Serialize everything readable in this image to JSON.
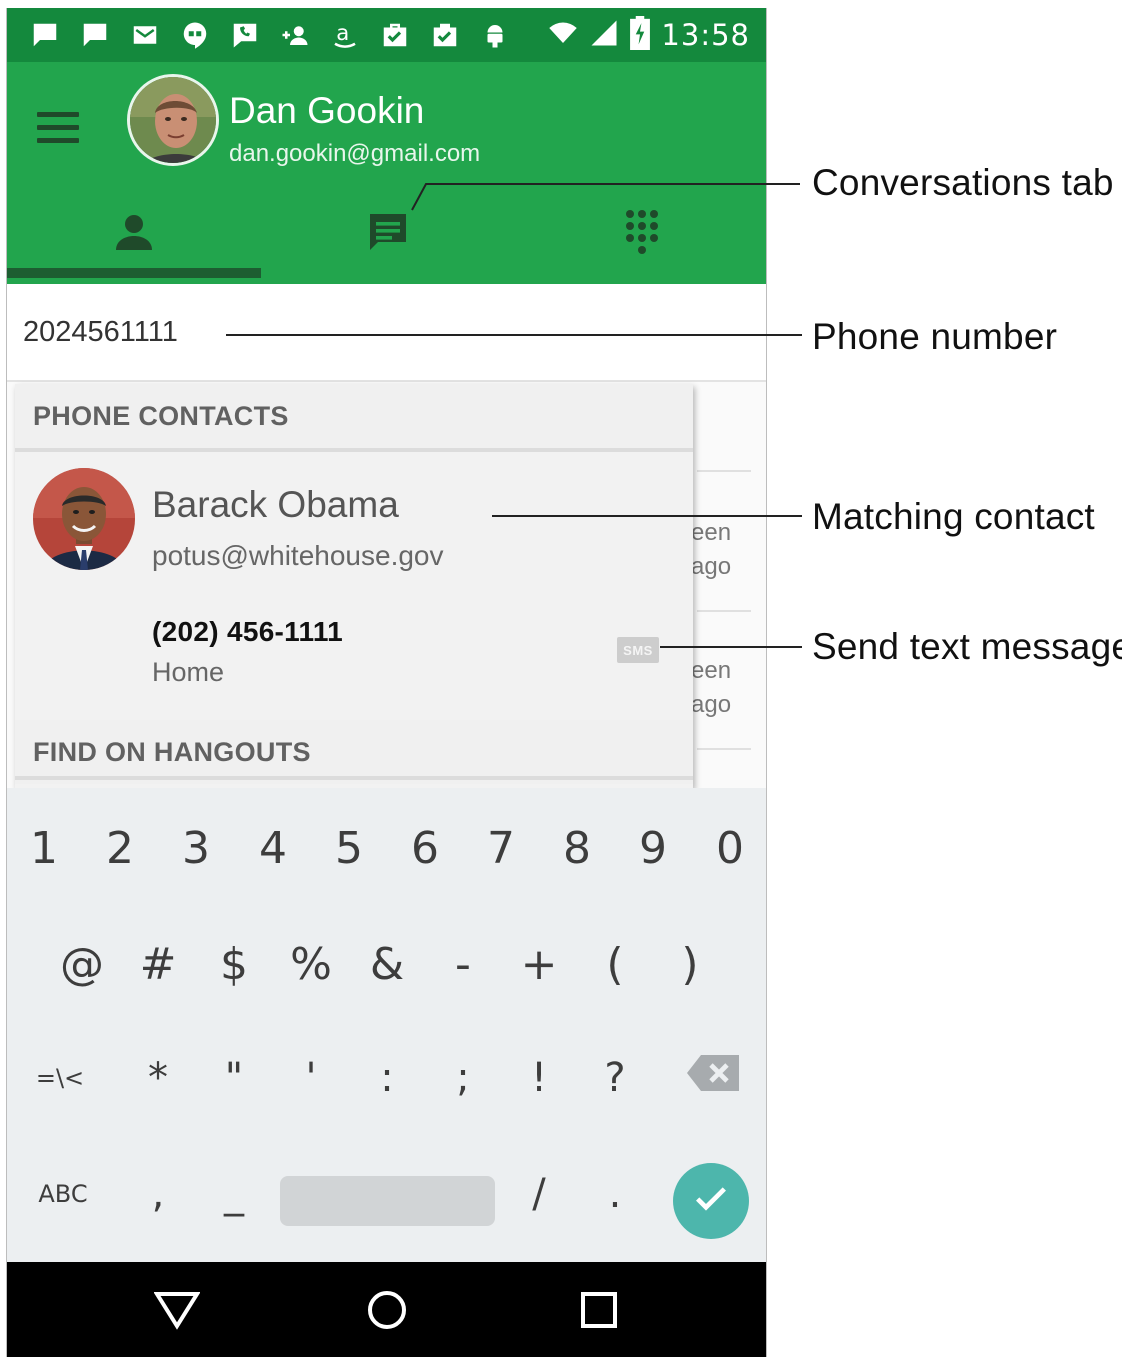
{
  "status_bar": {
    "time": "13:58",
    "notification_icons": [
      "chat-icon",
      "chat-icon",
      "gmail-icon",
      "hangouts-icon",
      "phone-message-icon",
      "add-person-icon",
      "amazon-icon",
      "bag-check-icon",
      "clipboard-check-icon",
      "android-icon"
    ],
    "system_icons": [
      "wifi-icon",
      "signal-icon",
      "battery-charging-icon"
    ]
  },
  "account": {
    "name": "Dan Gookin",
    "email": "dan.gookin@gmail.com"
  },
  "tabs": [
    {
      "id": "contacts",
      "icon": "person-icon",
      "selected": true
    },
    {
      "id": "conversations",
      "icon": "message-icon",
      "selected": false
    },
    {
      "id": "dialpad",
      "icon": "dialpad-icon",
      "selected": false
    }
  ],
  "phone_input": {
    "value": "2024561111"
  },
  "background_list": {
    "items": [
      {
        "time_line1": "een",
        "time_line2": "ago"
      },
      {
        "time_line1": "een",
        "time_line2": "ago"
      }
    ]
  },
  "suggestions": {
    "phone_contacts_header": "PHONE CONTACTS",
    "contact": {
      "name": "Barack Obama",
      "email": "potus@whitehouse.gov",
      "phone": "(202) 456-1111",
      "phone_type": "Home",
      "sms_label": "SMS"
    },
    "find_header": "FIND ON HANGOUTS"
  },
  "keyboard": {
    "row1": [
      "1",
      "2",
      "3",
      "4",
      "5",
      "6",
      "7",
      "8",
      "9",
      "0"
    ],
    "row2": [
      "@",
      "#",
      "$",
      "%",
      "&",
      "-",
      "+",
      "(",
      ")"
    ],
    "row3": [
      "=\\<",
      "*",
      "\"",
      "'",
      ":",
      ";",
      "!",
      "?"
    ],
    "row4": [
      "ABC",
      ",",
      "_",
      "/",
      "."
    ]
  },
  "callouts": {
    "conversations_tab": "Conversations tab",
    "phone_number": "Phone number",
    "matching_contact": "Matching contact",
    "send_text": "Send text message"
  },
  "colors": {
    "status_bar": "#14893d",
    "app_bar": "#22a54d",
    "tab_indicator": "#1d5d31",
    "done_key": "#4db6ac"
  }
}
